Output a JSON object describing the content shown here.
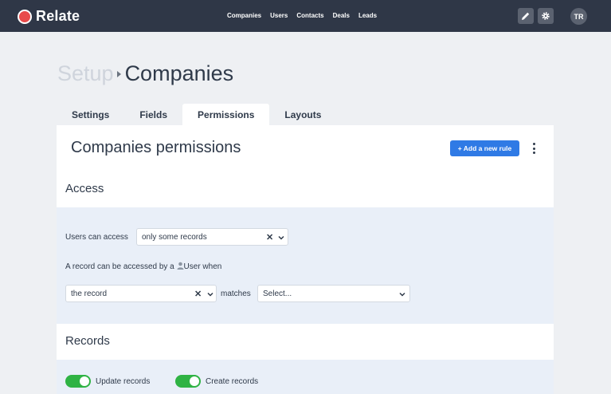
{
  "app": {
    "name": "Relate"
  },
  "nav": {
    "items": [
      "Companies",
      "Users",
      "Contacts",
      "Deals",
      "Leads"
    ]
  },
  "header": {
    "edit_icon": "pencil-icon",
    "settings_icon": "gear-icon",
    "avatar_initials": "TR"
  },
  "breadcrumb": {
    "parent": "Setup",
    "current": "Companies"
  },
  "tabs": [
    {
      "label": "Settings",
      "active": false
    },
    {
      "label": "Fields",
      "active": false
    },
    {
      "label": "Permissions",
      "active": true
    },
    {
      "label": "Layouts",
      "active": false
    }
  ],
  "card": {
    "title": "Companies permissions",
    "add_button": "+ Add a new rule"
  },
  "access": {
    "title": "Access",
    "users_can_access_label": "Users can access",
    "users_can_access_value": "only some records",
    "record_accessed_prefix": "A record can be accessed by a",
    "record_accessed_user": "User when",
    "subject_value": "the record",
    "matches_label": "matches",
    "match_placeholder": "Select..."
  },
  "records": {
    "title": "Records",
    "toggles": [
      {
        "label": "Update records",
        "on": true
      },
      {
        "label": "Create records",
        "on": true
      }
    ]
  },
  "colors": {
    "topbar": "#2f3747",
    "accent": "#2f7ae5",
    "toggle_on": "#2fb344",
    "logo": "#e84a4a"
  }
}
